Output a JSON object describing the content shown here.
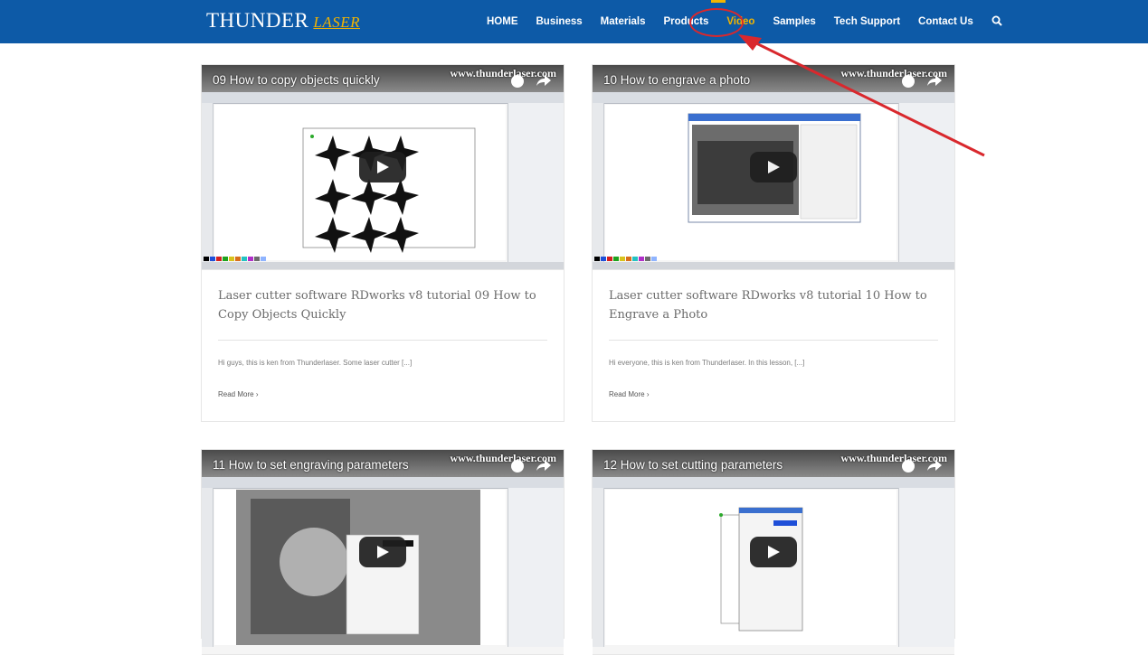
{
  "header": {
    "logo_main": "THUNDER",
    "logo_accent": "LASER",
    "nav": [
      "HOME",
      "Business",
      "Materials",
      "Products",
      "Video",
      "Samples",
      "Tech Support",
      "Contact Us"
    ],
    "active_item": "Video",
    "search_icon": "search-icon"
  },
  "colors": {
    "header_bg": "#0d5aa7",
    "accent": "#f3b400",
    "annotation": "#d9282d"
  },
  "cards": [
    {
      "video_title": "09 How to copy objects quickly",
      "watermark": "www.thunderlaser.com",
      "title": "Laser cutter software RDworks v8 tutorial 09 How to Copy Objects Quickly",
      "excerpt": "Hi guys, this is ken from Thunderlaser. Some laser cutter [...]",
      "read_more": "Read More"
    },
    {
      "video_title": "10 How to engrave a photo",
      "watermark": "www.thunderlaser.com",
      "title": "Laser cutter software RDworks v8 tutorial 10 How to Engrave a Photo",
      "excerpt": "Hi everyone, this is ken from Thunderlaser. In this lesson, [...]",
      "read_more": "Read More"
    },
    {
      "video_title": "11 How to set engraving parameters",
      "watermark": "www.thunderlaser.com"
    },
    {
      "video_title": "12 How to set cutting parameters",
      "watermark": "www.thunderlaser.com"
    }
  ]
}
